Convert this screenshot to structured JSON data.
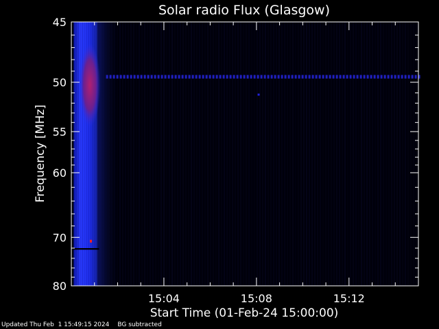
{
  "chart_data": {
    "type": "heatmap",
    "title": "Solar radio Flux (Glasgow)",
    "xlabel": "Start Time (01-Feb-24 15:00:00)",
    "ylabel": "Frequency [MHz]",
    "x_unit": "minutes after 15:00:00 UT",
    "xlim": [
      0,
      15
    ],
    "ylim": [
      45,
      80
    ],
    "y_tick_values": [
      45,
      50,
      55,
      60,
      70,
      80
    ],
    "y_tick_labels": [
      "45",
      "50",
      "55",
      "60",
      "70",
      "80"
    ],
    "x_tick_values": [
      4,
      8,
      12
    ],
    "x_tick_labels": [
      "15:04",
      "15:08",
      "15:12"
    ],
    "grid": false,
    "features": [
      {
        "name": "burst",
        "x_start": 0.1,
        "x_end": 1.2,
        "f_start": 45,
        "f_end": 80,
        "color": "#1e2cff"
      },
      {
        "name": "burst-core",
        "x_start": 0.35,
        "x_end": 1.25,
        "f_start": 47,
        "f_end": 54,
        "color": "#a0208c"
      },
      {
        "name": "interference-line",
        "x_start": 1.5,
        "x_end": 15,
        "f_start": 49.4,
        "f_end": 49.6,
        "color": "#2020c0"
      },
      {
        "name": "dark-gap",
        "x_start": 0,
        "x_end": 1.2,
        "f_start": 72.0,
        "f_end": 72.3,
        "color": "#000000"
      }
    ],
    "colors": {
      "background": "#000000",
      "axis": "#ffffff",
      "signal_low": "#00002a",
      "signal_high": "#ff2020"
    }
  },
  "footer": {
    "updated": "Updated Thu Feb  1 15:49:15 2024",
    "note": "BG subtracted"
  }
}
